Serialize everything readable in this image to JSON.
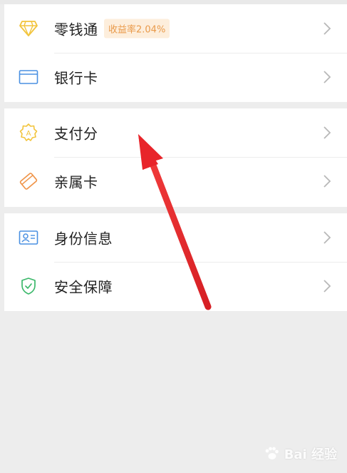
{
  "menu": {
    "items": [
      {
        "label": "零钱通",
        "badge": "收益率2.04%",
        "icon": "diamond-icon"
      },
      {
        "label": "银行卡",
        "icon": "bank-card-icon"
      },
      {
        "label": "支付分",
        "icon": "pay-score-icon"
      },
      {
        "label": "亲属卡",
        "icon": "family-card-icon"
      },
      {
        "label": "身份信息",
        "icon": "id-card-icon"
      },
      {
        "label": "安全保障",
        "icon": "shield-icon"
      }
    ]
  },
  "watermark": {
    "text": "Bai 经验"
  },
  "colors": {
    "background": "#ededed",
    "card": "#ffffff",
    "badge_bg": "#fdeedc",
    "badge_text": "#e99a4a",
    "arrow": "#e8242a"
  }
}
